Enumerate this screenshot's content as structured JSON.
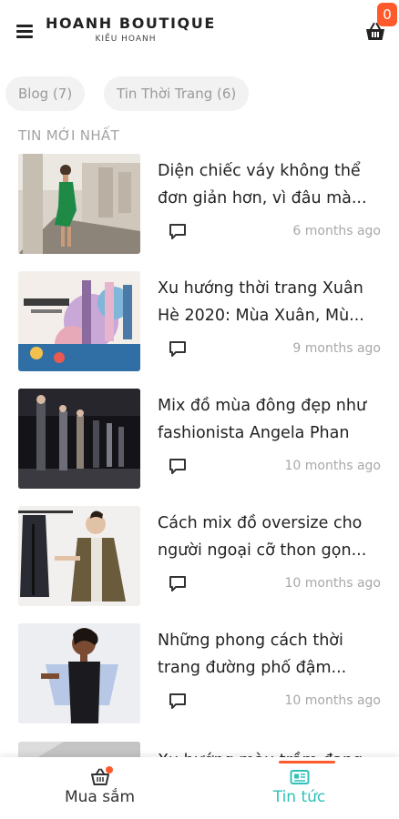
{
  "header": {
    "title": "HOANH BOUTIQUE",
    "subtitle": "KIỀU HOANH",
    "cart_count": "0"
  },
  "categories": [
    {
      "label": "Blog (7)"
    },
    {
      "label": "Tin Thời Trang (6)"
    }
  ],
  "section_title": "TIN MỚI NHẤT",
  "articles": [
    {
      "title": "Diện chiếc váy không thể đơn giản hơn, vì đâu mà...",
      "time": "6 months ago"
    },
    {
      "title": "Xu hướng thời trang Xuân Hè 2020: Mùa Xuân, Mù...",
      "time": "9 months ago"
    },
    {
      "title": "Mix đồ mùa đông đẹp như fashionista Angela Phan",
      "time": "10 months ago"
    },
    {
      "title": "Cách mix đồ oversize cho người ngoại cỡ thon gọn...",
      "time": "10 months ago"
    },
    {
      "title": "Những phong cách thời trang đường phố đậm...",
      "time": "10 months ago"
    },
    {
      "title": "Xu hướng màu trầm đang",
      "time": ""
    }
  ],
  "bottom_nav": [
    {
      "label": "Mua sắm",
      "icon": "basket-icon",
      "active": false
    },
    {
      "label": "Tin tức",
      "icon": "news-icon",
      "active": true
    }
  ],
  "colors": {
    "accent": "#2fc1b8",
    "badge": "#ff5a2c",
    "chip_bg": "#f2f2f2",
    "muted_text": "#a8a8a8"
  }
}
